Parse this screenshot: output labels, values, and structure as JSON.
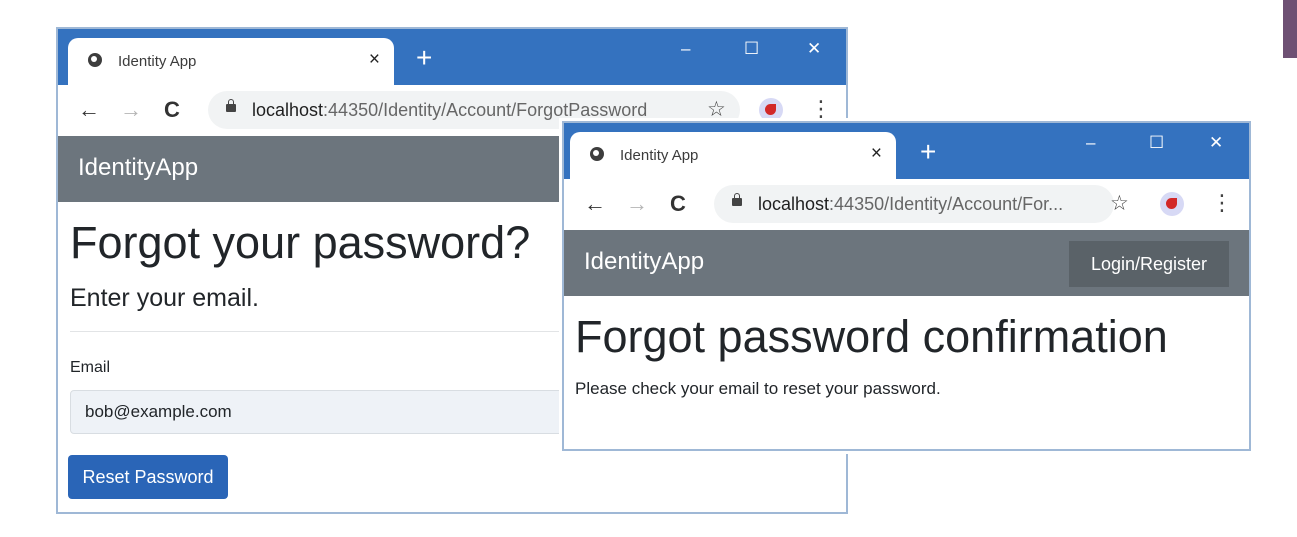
{
  "back_window": {
    "tab": {
      "title": "Identity App",
      "close": "×"
    },
    "new_tab": "+",
    "controls": {
      "minimize": "–",
      "maximize": "☐",
      "close": "✕"
    },
    "address": {
      "host": "localhost",
      "path": ":44350/Identity/Account/ForgotPassword"
    },
    "brand": "IdentityApp",
    "heading": "Forgot your password?",
    "subheading": "Enter your email.",
    "email_label": "Email",
    "email_value": "bob@example.com",
    "reset_label": "Reset Password"
  },
  "front_window": {
    "tab": {
      "title": "Identity App",
      "close": "×"
    },
    "new_tab": "+",
    "controls": {
      "minimize": "–",
      "maximize": "☐",
      "close": "✕"
    },
    "address": {
      "host": "localhost",
      "path": ":44350/Identity/Account/For..."
    },
    "brand": "IdentityApp",
    "login_label": "Login/Register",
    "heading": "Forgot password confirmation",
    "message": "Please check your email to reset your password."
  },
  "icons": {
    "back": "←",
    "forward": "→",
    "reload": "C",
    "star": "☆",
    "menu": "⋮"
  },
  "colors": {
    "titlebar": "#3472bf",
    "navbar": "#6c757d",
    "primary_button": "#2a65b7",
    "secondary_button": "#5a6268",
    "corner_tab": "#6e5073"
  }
}
